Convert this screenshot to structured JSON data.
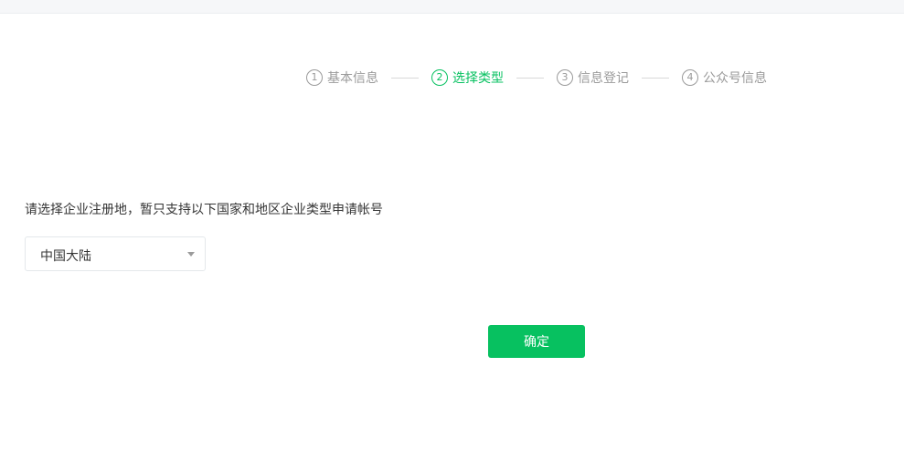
{
  "steps": [
    {
      "num": "1",
      "label": "基本信息",
      "active": false
    },
    {
      "num": "2",
      "label": "选择类型",
      "active": true
    },
    {
      "num": "3",
      "label": "信息登记",
      "active": false
    },
    {
      "num": "4",
      "label": "公众号信息",
      "active": false
    }
  ],
  "form": {
    "prompt": "请选择企业注册地，暂只支持以下国家和地区企业类型申请帐号",
    "region_select": {
      "selected": "中国大陆"
    },
    "confirm_label": "确定"
  },
  "colors": {
    "accent": "#07c160",
    "inactive_step": "#9a9a9a",
    "text": "#353535"
  }
}
